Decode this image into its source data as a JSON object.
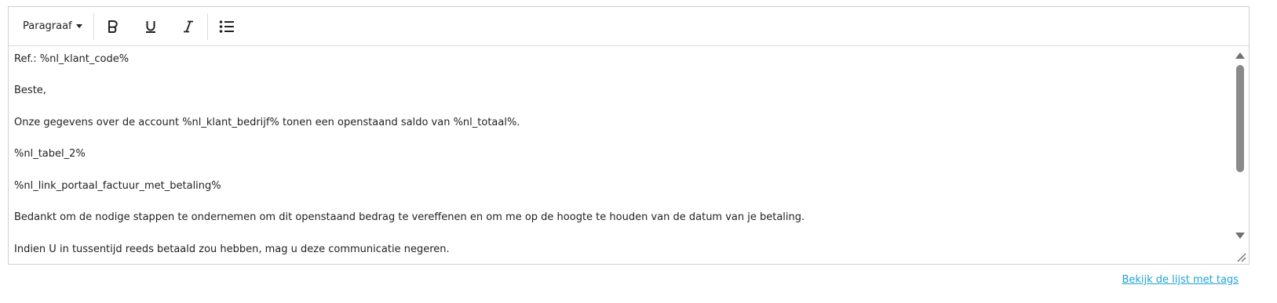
{
  "toolbar": {
    "format_label": "Paragraaf",
    "bold_icon": "bold-icon",
    "underline_icon": "underline-icon",
    "italic_icon": "italic-icon",
    "list_icon": "bulleted-list-icon"
  },
  "content": {
    "lines": [
      "Ref.: %nl_klant_code%",
      "Beste,",
      "Onze gegevens over de account %nl_klant_bedrijf% tonen een openstaand saldo van %nl_totaal%.",
      "%nl_tabel_2%",
      "%nl_link_portaal_factuur_met_betaling%",
      "Bedankt om de nodige stappen te ondernemen om dit openstaand bedrag te vereffenen en om me op de hoogte te houden van de datum van je betaling.",
      "Indien U in tussentijd reeds betaald zou hebben, mag u deze communicatie negeren."
    ]
  },
  "footer": {
    "tags_link": "Bekijk de lijst met tags"
  },
  "colors": {
    "link": "#1fa3d9",
    "border": "#cfcfcf",
    "scroll_thumb": "#8a8a8a"
  }
}
